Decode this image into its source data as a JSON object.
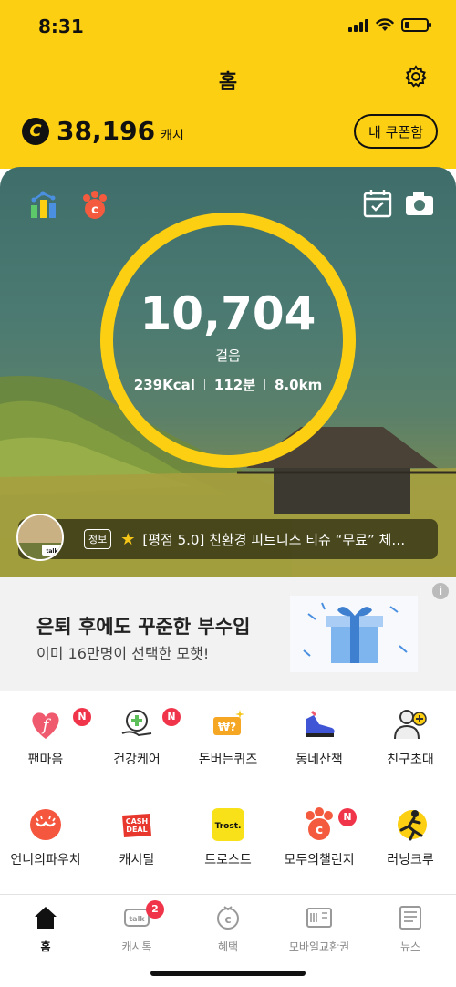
{
  "status": {
    "time": "8:31"
  },
  "header": {
    "title": "홈",
    "cash_amount": "38,196",
    "cash_unit": "캐시",
    "coupon_button": "내 쿠폰함",
    "coin_symbol": "C"
  },
  "hero": {
    "steps": "10,704",
    "steps_label": "걸음",
    "kcal": "239Kcal",
    "minutes": "112분",
    "distance": "8.0km",
    "notice_tag": "정보",
    "notice_text": "[평점 5.0] 친환경 피트니스 티슈 “무료” 체…",
    "avatar_text": "cash talk"
  },
  "ad": {
    "info": "i",
    "headline": "은퇴 후에도 꾸준한 부수입",
    "sub": "이미 16만명이 선택한 모햇!"
  },
  "menu": {
    "row1": [
      {
        "label": "팬마음",
        "badge": "N",
        "icon": "fan-heart-icon"
      },
      {
        "label": "건강케어",
        "badge": "N",
        "icon": "health-care-icon"
      },
      {
        "label": "돈버는퀴즈",
        "badge": "",
        "icon": "money-quiz-icon"
      },
      {
        "label": "동네산책",
        "badge": "",
        "icon": "sneaker-icon"
      },
      {
        "label": "친구초대",
        "badge": "",
        "icon": "invite-friend-icon"
      }
    ],
    "row2": [
      {
        "label": "언니의파우치",
        "badge": "",
        "icon": "pouch-icon"
      },
      {
        "label": "캐시딜",
        "badge": "",
        "icon": "cash-deal-icon",
        "icon_text": "CASH DEAL"
      },
      {
        "label": "트로스트",
        "badge": "",
        "icon": "trost-icon",
        "icon_text": "Trost."
      },
      {
        "label": "모두의챌린지",
        "badge": "N",
        "icon": "challenge-paw-icon"
      },
      {
        "label": "러닝크루",
        "badge": "",
        "icon": "runner-icon"
      }
    ]
  },
  "nav": [
    {
      "label": "홈",
      "icon": "home-icon",
      "active": true
    },
    {
      "label": "캐시톡",
      "icon": "talk-icon",
      "badge": "2"
    },
    {
      "label": "혜택",
      "icon": "benefit-icon"
    },
    {
      "label": "모바일교환권",
      "icon": "voucher-icon"
    },
    {
      "label": "뉴스",
      "icon": "news-icon"
    }
  ],
  "colors": {
    "brand_yellow": "#FCCF12",
    "badge_red": "#F0344A"
  }
}
